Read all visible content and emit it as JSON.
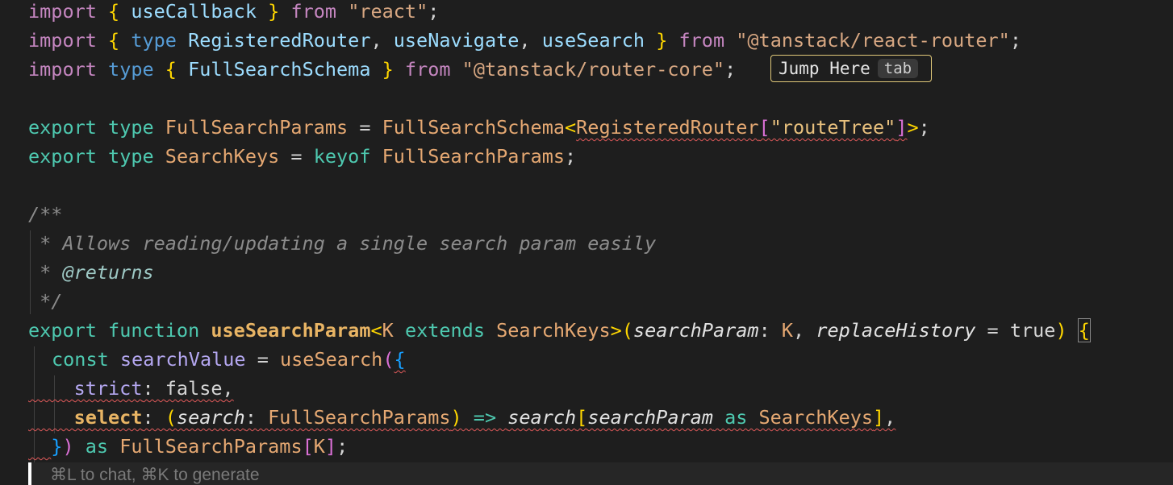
{
  "code": {
    "l1": {
      "import": "import",
      "open": "{ ",
      "ident": "useCallback",
      "close": " }",
      "from": "from",
      "str": "\"react\"",
      "semi": ";"
    },
    "l2": {
      "import": "import",
      "open": "{ ",
      "type": "type",
      "ident1": "RegisteredRouter",
      "comma1": ", ",
      "ident2": "useNavigate",
      "comma2": ", ",
      "ident3": "useSearch",
      "close": " }",
      "from": "from",
      "str": "\"@tanstack/react-router\"",
      "semi": ";"
    },
    "l3": {
      "import": "import",
      "type": "type",
      "open": "{ ",
      "ident": "FullSearchSchema",
      "close": " }",
      "from": "from",
      "str": "\"@tanstack/router-core\"",
      "semi": ";"
    },
    "l5": {
      "export": "export",
      "type": "type",
      "name": "FullSearchParams",
      "eq": " = ",
      "schema": "FullSearchSchema",
      "lt": "<",
      "router": "RegisteredRouter",
      "lb": "[",
      "str": "\"routeTree\"",
      "rb": "]",
      "gt": ">",
      "semi": ";"
    },
    "l6": {
      "export": "export",
      "type": "type",
      "name": "SearchKeys",
      "eq": " = ",
      "keyof": "keyof",
      "ref": "FullSearchParams",
      "semi": ";"
    },
    "l8": "/**",
    "l9": " * Allows reading/updating a single search param easily",
    "l10": {
      "star": " * ",
      "tag": "@returns"
    },
    "l11": " */",
    "l12": {
      "export": "export",
      "function": "function",
      "name": "useSearchParam",
      "lt": "<",
      "k": "K",
      "extends": "extends",
      "keys": "SearchKeys",
      "gt": ">",
      "lp": "(",
      "p1": "searchParam",
      "colon1": ": ",
      "k2": "K",
      "comma": ", ",
      "p2": "replaceHistory",
      "eq": " = ",
      "true": "true",
      "rp": ")",
      "lbrace": "{"
    },
    "l13": {
      "const": "const",
      "name": "searchValue",
      "eq": " = ",
      "fn": "useSearch",
      "lp": "(",
      "lbrace": "{"
    },
    "l14": {
      "prop": "strict",
      "colon": ": ",
      "val": "false",
      "comma": ","
    },
    "l15": {
      "prop": "select",
      "colon": ": ",
      "lp": "(",
      "param": "search",
      "colon2": ": ",
      "type": "FullSearchParams",
      "rp": ")",
      "arrow": " => ",
      "search": "search",
      "lb": "[",
      "sp": "searchParam",
      "as": " as ",
      "keys": "SearchKeys",
      "rb": "]",
      "comma": ","
    },
    "l16": {
      "rbrace": "}",
      "rp": ")",
      "as": "as",
      "type": "FullSearchParams",
      "lb": "[",
      "k": "K",
      "rb": "]",
      "semi": ";"
    }
  },
  "jump_here": {
    "label": "Jump Here",
    "key": "tab"
  },
  "chat_hint": "⌘L to chat, ⌘K to generate",
  "colors": {
    "background": "#1e1e1e",
    "squiggle": "#e05a5a",
    "jump_border": "#e0c879"
  }
}
